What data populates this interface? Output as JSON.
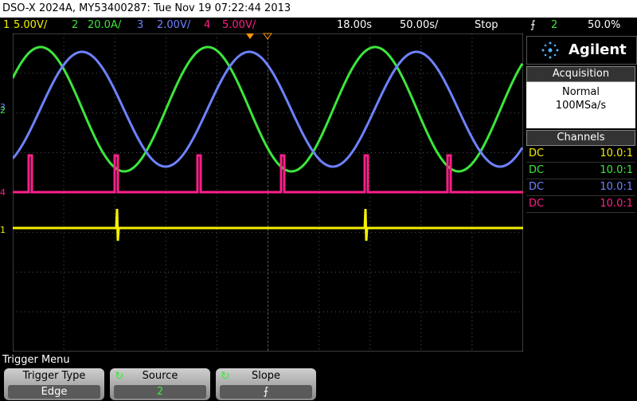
{
  "title_bar": {
    "text": "DSO-X 2024A, MY53400287: Tue Nov 19 07:22:44 2013"
  },
  "status_bar": {
    "ch1_num": "1",
    "ch1_scale": "5.00V/",
    "ch2_num": "2",
    "ch2_scale": "20.0A/",
    "ch3_num": "3",
    "ch3_scale": "2.00V/",
    "ch4_num": "4",
    "ch4_scale": "5.00V/",
    "delay": "18.00s",
    "timebase": "50.00s/",
    "run_state": "Stop",
    "trigger_slope_glyph": "⨍",
    "trigger_source": "2",
    "trigger_level": "50.0%"
  },
  "colors": {
    "ch1": "#f4f000",
    "ch2": "#3ce63c",
    "ch3": "#6e82ff",
    "ch4": "#ff1f8a",
    "grid": "#555555"
  },
  "channel_markers": {
    "ch1": "1",
    "ch2": "2",
    "ch3": "3",
    "ch4": "4",
    "trig": "T"
  },
  "brand": {
    "name": "Agilent",
    "icon": "spark-logo-icon"
  },
  "acquisition": {
    "header": "Acquisition",
    "mode": "Normal",
    "rate": "100MSa/s"
  },
  "channels": {
    "header": "Channels",
    "rows": [
      {
        "coupling": "DC",
        "probe": "10.0:1"
      },
      {
        "coupling": "DC",
        "probe": "10.0:1"
      },
      {
        "coupling": "DC",
        "probe": "10.0:1"
      },
      {
        "coupling": "DC",
        "probe": "10.0:1"
      }
    ]
  },
  "menu": {
    "title": "Trigger Menu"
  },
  "softkeys": [
    {
      "label": "Trigger Type",
      "value": "Edge"
    },
    {
      "label": "Source",
      "value": "2"
    },
    {
      "label": "Slope",
      "value": "⨍"
    }
  ]
}
